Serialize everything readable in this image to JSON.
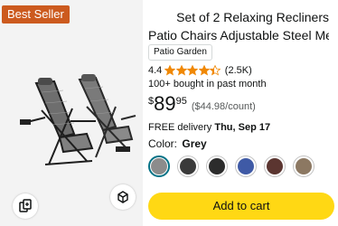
{
  "product": {
    "badge": "Best Seller",
    "title_line1": "Set of 2 Relaxing Recliners",
    "title_line2": "Patio Chairs Adjustable Steel Mes...",
    "store": "Patio Garden",
    "rating": "4.4",
    "stars": 4.4,
    "review_count": "(2.5K)",
    "bought": "100+ bought in past month",
    "price": {
      "currency": "$",
      "whole": "89",
      "fraction": "95",
      "unit_price": "($44.98/count)"
    },
    "delivery": {
      "prefix": "FREE delivery",
      "date": "Thu, Sep 17"
    },
    "color_label": "Color:",
    "color_value": "Grey",
    "swatches": [
      {
        "color": "#8c8c8c",
        "selected": true
      },
      {
        "color": "#3a3a3a",
        "selected": false
      },
      {
        "color": "#2c2c2c",
        "selected": false
      },
      {
        "color": "#3f5aa6",
        "selected": false
      },
      {
        "color": "#5b3530",
        "selected": false
      },
      {
        "color": "#8c7862",
        "selected": false
      }
    ],
    "cart_label": "Add to cart"
  },
  "colors": {
    "badge": "#cc5a1e",
    "star": "#f08804",
    "cart": "#ffd814"
  }
}
